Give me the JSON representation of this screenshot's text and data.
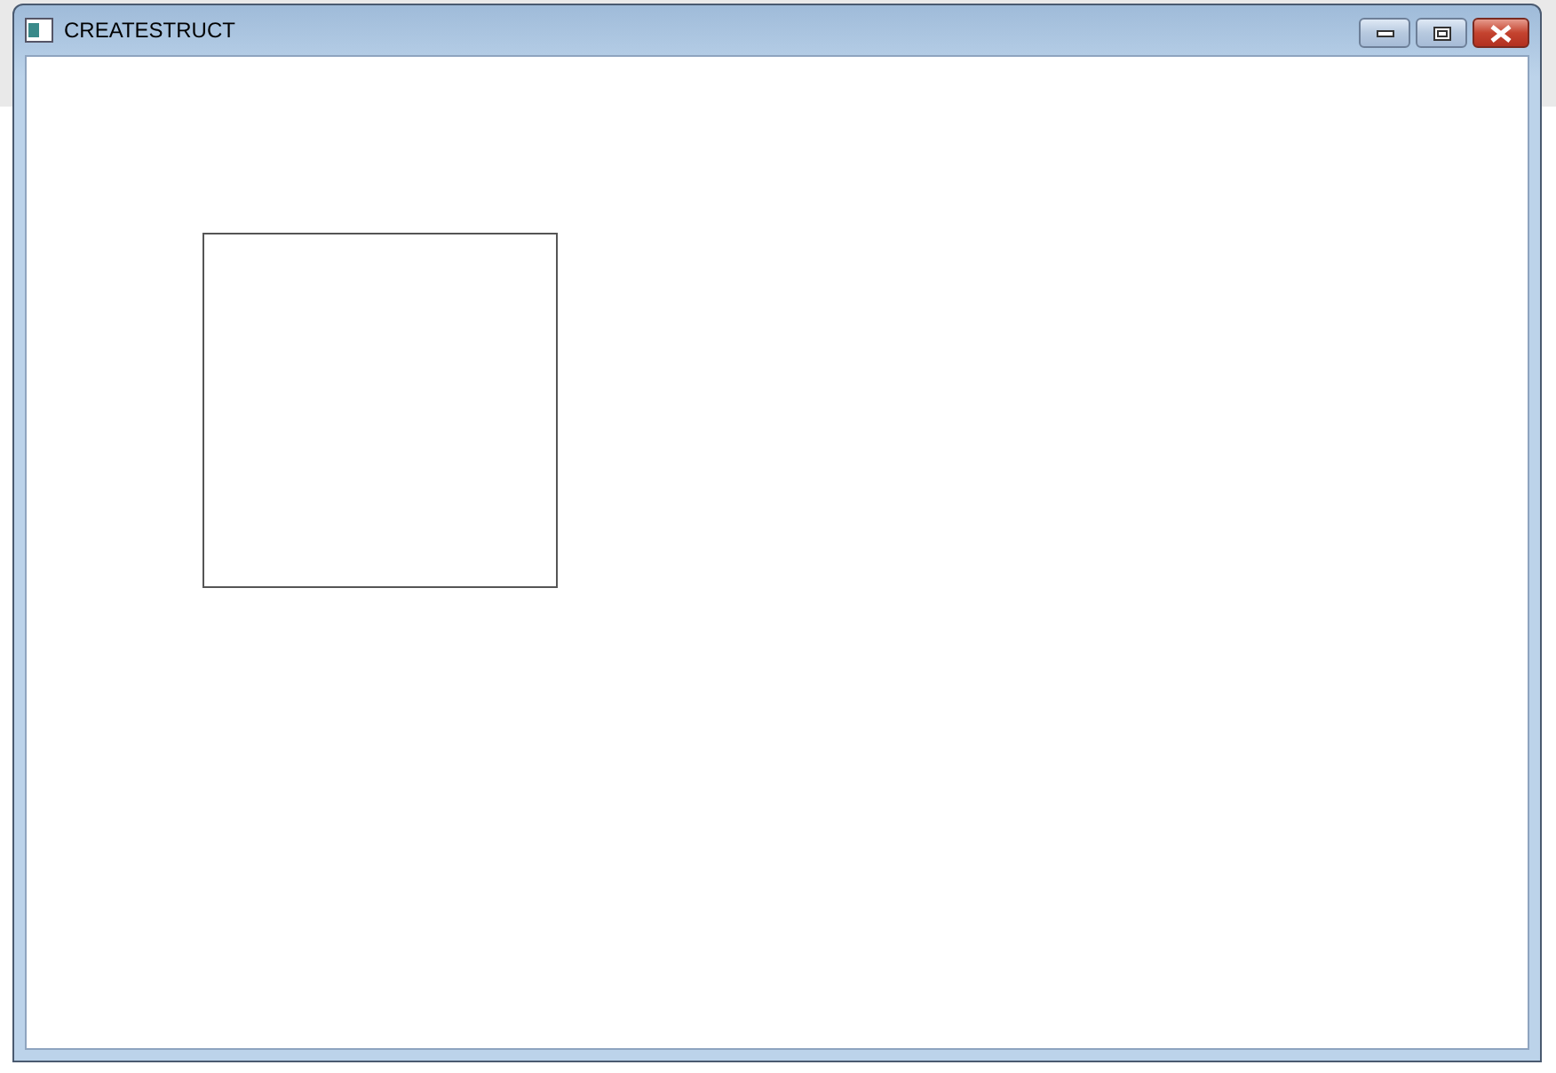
{
  "window": {
    "title": "CREATESTRUCT"
  }
}
